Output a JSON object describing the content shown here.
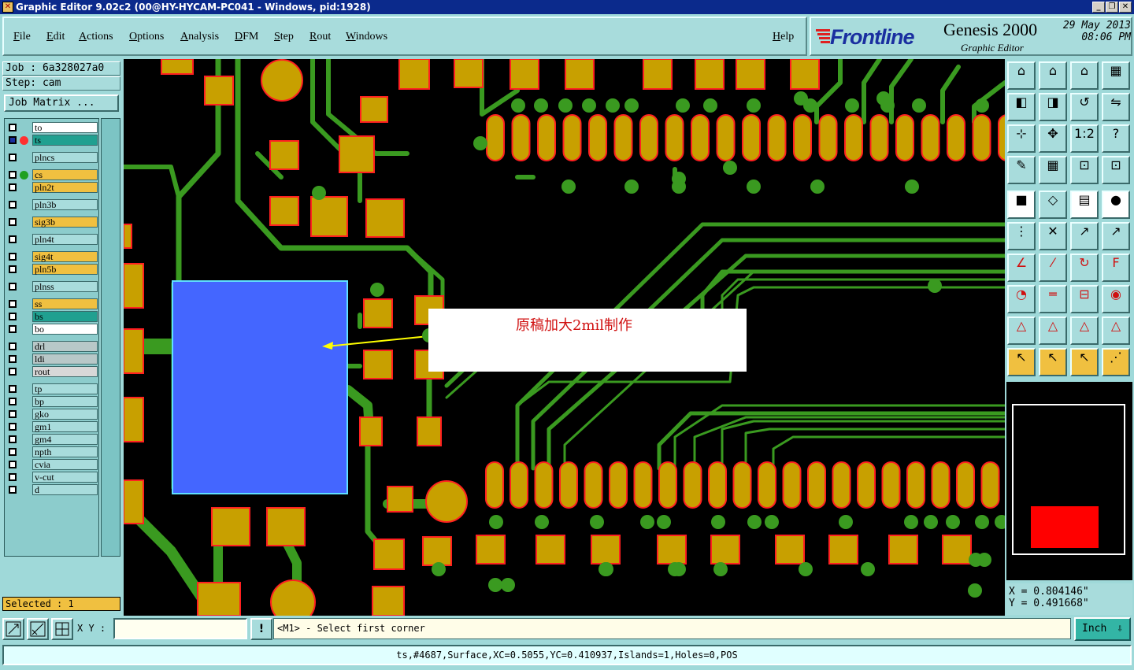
{
  "window": {
    "title": "Graphic Editor 9.02c2 (00@HY-HYCAM-PC041 - Windows, pid:1928)",
    "controls": [
      "_",
      "❐",
      "✕"
    ]
  },
  "menu": [
    "File",
    "Edit",
    "Actions",
    "Options",
    "Analysis",
    "DFM",
    "Step",
    "Rout",
    "Windows"
  ],
  "help_label": "Help",
  "brand": {
    "logo": "Frontline",
    "product": "Genesis 2000",
    "subtitle": "Graphic Editor",
    "date": "29 May 2013",
    "time": "08:06 PM"
  },
  "job": {
    "job_label": "Job : 6a328027a0",
    "step_label": "Step: cam",
    "matrix_button": "Job Matrix ..."
  },
  "layers": [
    {
      "name": "to",
      "color": "#ffffff",
      "state": "white"
    },
    {
      "name": "ts",
      "color": "#20a090",
      "state": "work"
    },
    {
      "name": "plncs",
      "color": "#a8dcdc",
      "state": ""
    },
    {
      "name": "cs",
      "color": "#f0c040",
      "state": "green"
    },
    {
      "name": "pln2t",
      "color": "#f0c040",
      "state": ""
    },
    {
      "name": "pln3b",
      "color": "#a8dcdc",
      "state": ""
    },
    {
      "name": "sig3b",
      "color": "#f0c040",
      "state": ""
    },
    {
      "name": "pln4t",
      "color": "#a8dcdc",
      "state": ""
    },
    {
      "name": "sig4t",
      "color": "#f0c040",
      "state": ""
    },
    {
      "name": "pln5b",
      "color": "#f0c040",
      "state": ""
    },
    {
      "name": "plnss",
      "color": "#a8dcdc",
      "state": ""
    },
    {
      "name": "ss",
      "color": "#f0c040",
      "state": ""
    },
    {
      "name": "bs",
      "color": "#20a090",
      "state": ""
    },
    {
      "name": "bo",
      "color": "#ffffff",
      "state": ""
    },
    {
      "name": "drl",
      "color": "#b8c8c8",
      "state": ""
    },
    {
      "name": "ldi",
      "color": "#b8c8c8",
      "state": ""
    },
    {
      "name": "rout",
      "color": "#d8d8d8",
      "state": ""
    },
    {
      "name": "tp",
      "color": "#a8dcdc",
      "state": ""
    },
    {
      "name": "bp",
      "color": "#a8dcdc",
      "state": ""
    },
    {
      "name": "gko",
      "color": "#a8dcdc",
      "state": ""
    },
    {
      "name": "gm1",
      "color": "#a8dcdc",
      "state": ""
    },
    {
      "name": "gm4",
      "color": "#a8dcdc",
      "state": ""
    },
    {
      "name": "npth",
      "color": "#a8dcdc",
      "state": ""
    },
    {
      "name": "cvia",
      "color": "#a8dcdc",
      "state": ""
    },
    {
      "name": "v-cut",
      "color": "#a8dcdc",
      "state": ""
    },
    {
      "name": "d",
      "color": "#a8dcdc",
      "state": ""
    }
  ],
  "selected_label": "Selected : 1",
  "annotation": "原稿加大2mil制作",
  "coords": {
    "x": "X  = 0.804146\"",
    "y": "Y  = 0.491668\""
  },
  "command": {
    "xy_label": "X Y :",
    "xy_value": "",
    "warn_label": "!",
    "prompt": "<M1> - Select first corner",
    "units": "Inch"
  },
  "status": "ts,#4687,Surface,XC=0.5055,YC=0.410937,Islands=1,Holes=0,POS",
  "colors": {
    "pad": "#c8a000",
    "pad_outline": "#ff2020",
    "trace": "#3a9a20",
    "selection": "#4466ff",
    "selection_outline": "#60e0ff",
    "background": "#000000"
  }
}
